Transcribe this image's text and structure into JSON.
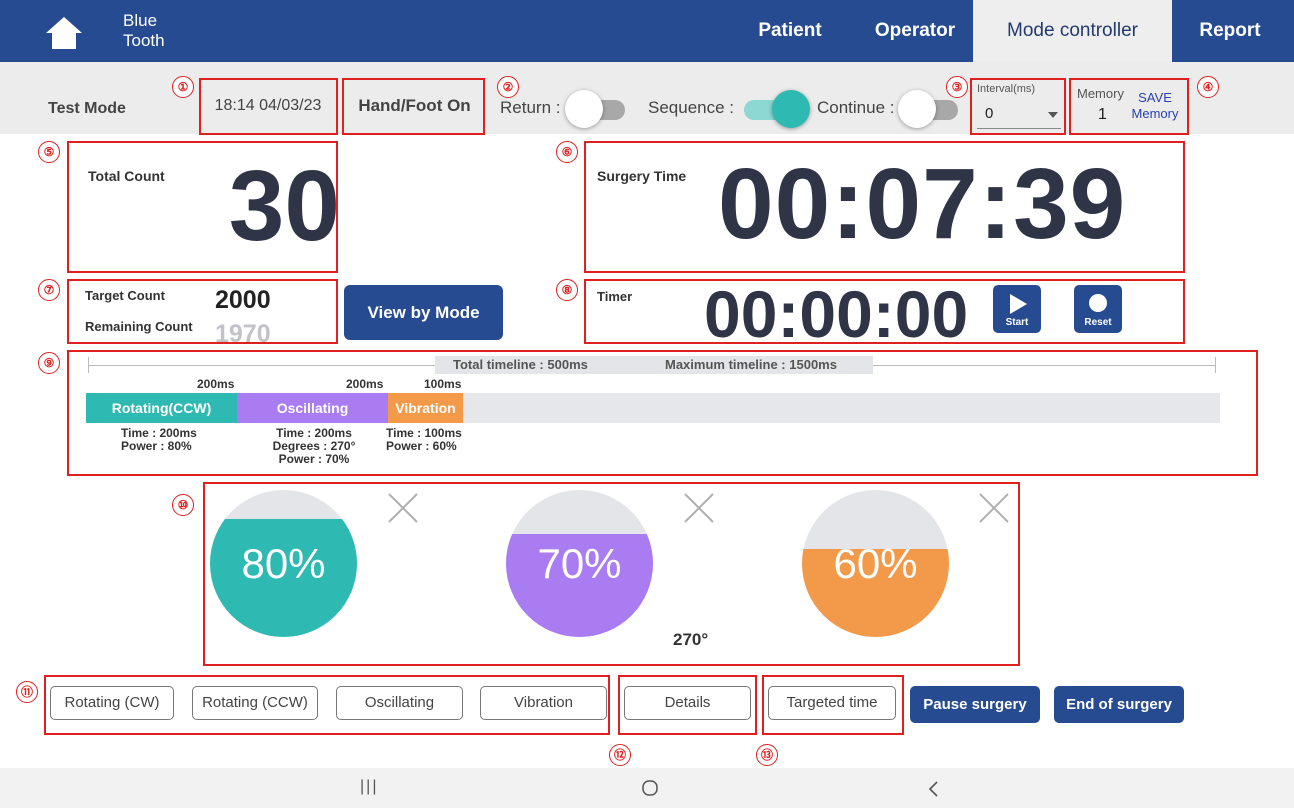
{
  "header": {
    "bt_label": "Blue\nTooth",
    "nav": {
      "patient": "Patient",
      "operator": "Operator",
      "mode_controller": "Mode controller",
      "report": "Report"
    }
  },
  "mode_bar": {
    "test_mode": "Test Mode",
    "datetime": "18:14 04/03/23",
    "hand_foot": "Hand/Foot On",
    "return_label": "Return :",
    "return_on": false,
    "sequence_label": "Sequence :",
    "sequence_on": true,
    "continue_label": "Continue :",
    "continue_on": false,
    "interval_label": "Interval(ms)",
    "interval_value": "0",
    "memory_label": "Memory",
    "memory_value": "1",
    "save_memory": "SAVE\nMemory"
  },
  "counts": {
    "total_count_label": "Total Count",
    "total_count": "30",
    "surgery_time_label": "Surgery Time",
    "surgery_time": "00:07:39",
    "target_count_label": "Target Count",
    "target_count": "2000",
    "remaining_count_label": "Remaining Count",
    "remaining_count": "1970",
    "view_by_mode": "View by Mode",
    "timer_label": "Timer",
    "timer_value": "00:00:00",
    "start": "Start",
    "reset": "Reset"
  },
  "timeline": {
    "total": "Total timeline :   500ms",
    "maximum": "Maximum timeline : 1500ms",
    "segments": [
      {
        "name": "Rotating(CCW)",
        "duration": "200ms",
        "details": "Time : 200ms\nPower : 80%",
        "color": "#2ebab2"
      },
      {
        "name": "Oscillating",
        "duration": "200ms",
        "details": "Time : 200ms\nDegrees : 270°\nPower : 70%",
        "color": "#a97cf2"
      },
      {
        "name": "Vibration",
        "duration": "100ms",
        "details": "Time : 100ms\nPower : 60%",
        "color": "#f39a4a"
      }
    ]
  },
  "gauges": [
    {
      "percent": "80%",
      "level": 0.8,
      "color": "#2ebab2"
    },
    {
      "percent": "70%",
      "level": 0.7,
      "color": "#a97cf2",
      "degrees": "270°"
    },
    {
      "percent": "60%",
      "level": 0.6,
      "color": "#f39a4a"
    }
  ],
  "bottom_buttons": {
    "rotating_cw": "Rotating (CW)",
    "rotating_ccw": "Rotating (CCW)",
    "oscillating": "Oscillating",
    "vibration": "Vibration",
    "details": "Details",
    "targeted_time": "Targeted time",
    "pause_surgery": "Pause surgery",
    "end_of_surgery": "End of surgery"
  },
  "callouts": [
    "①",
    "②",
    "③",
    "④",
    "⑤",
    "⑥",
    "⑦",
    "⑧",
    "⑨",
    "⑩",
    "⑪",
    "⑫",
    "⑬"
  ],
  "android_nav": {
    "recents": "|||"
  }
}
